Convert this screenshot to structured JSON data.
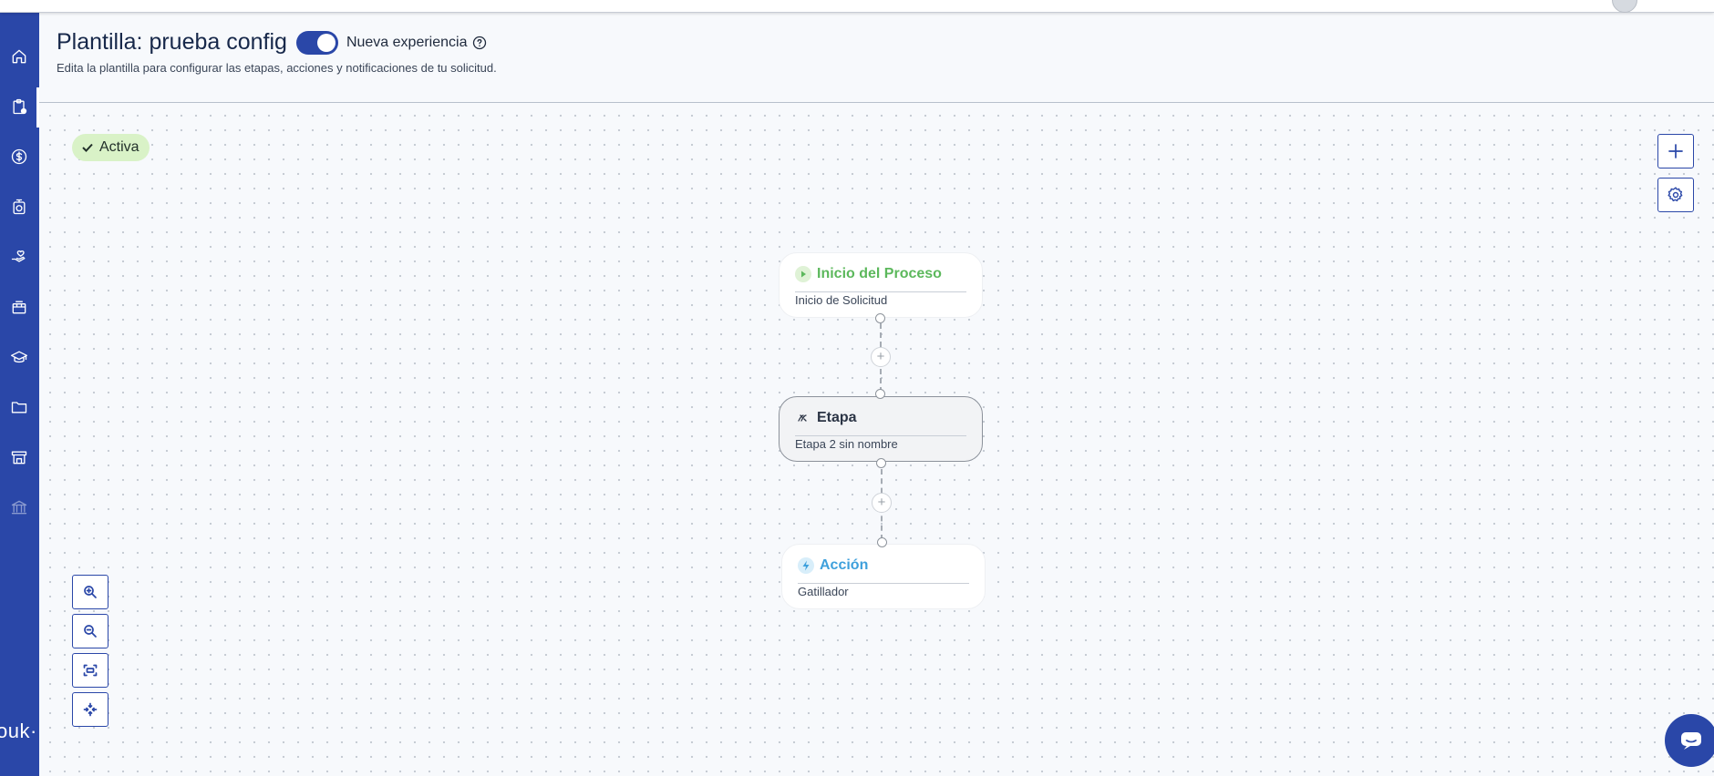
{
  "header": {
    "title": "Plantilla: prueba config",
    "toggle_label": "Nueva experiencia",
    "toggle_on": true,
    "subtitle": "Edita la plantilla para configurar las etapas, acciones y notificaciones de tu solicitud."
  },
  "sidebar": {
    "items": [
      {
        "icon": "home-icon"
      },
      {
        "icon": "clipboard-icon",
        "active": true
      },
      {
        "icon": "dollar-icon"
      },
      {
        "icon": "clock-icon"
      },
      {
        "icon": "hand-heart-icon"
      },
      {
        "icon": "gift-icon"
      },
      {
        "icon": "graduation-cap-icon"
      },
      {
        "icon": "folder-icon"
      },
      {
        "icon": "store-icon"
      },
      {
        "icon": "bank-icon"
      }
    ],
    "brand": "ouk·"
  },
  "status": {
    "label": "Activa",
    "color": "#d9f2c7"
  },
  "flow": {
    "nodes": [
      {
        "title": "Inicio del Proceso",
        "subtitle": "Inicio de Solicitud",
        "color": "#5cb85c",
        "icon": "play-icon"
      },
      {
        "title": "Etapa",
        "subtitle": "Etapa 2 sin nombre",
        "color": "#2b3445",
        "icon": "stage-icon"
      },
      {
        "title": "Acción",
        "subtitle": "Gatillador",
        "color": "#3ea0dc",
        "icon": "bolt-icon"
      }
    ],
    "add_symbol": "+"
  },
  "colors": {
    "primary": "#2a47a8",
    "canvas": "#f7f9fc"
  }
}
